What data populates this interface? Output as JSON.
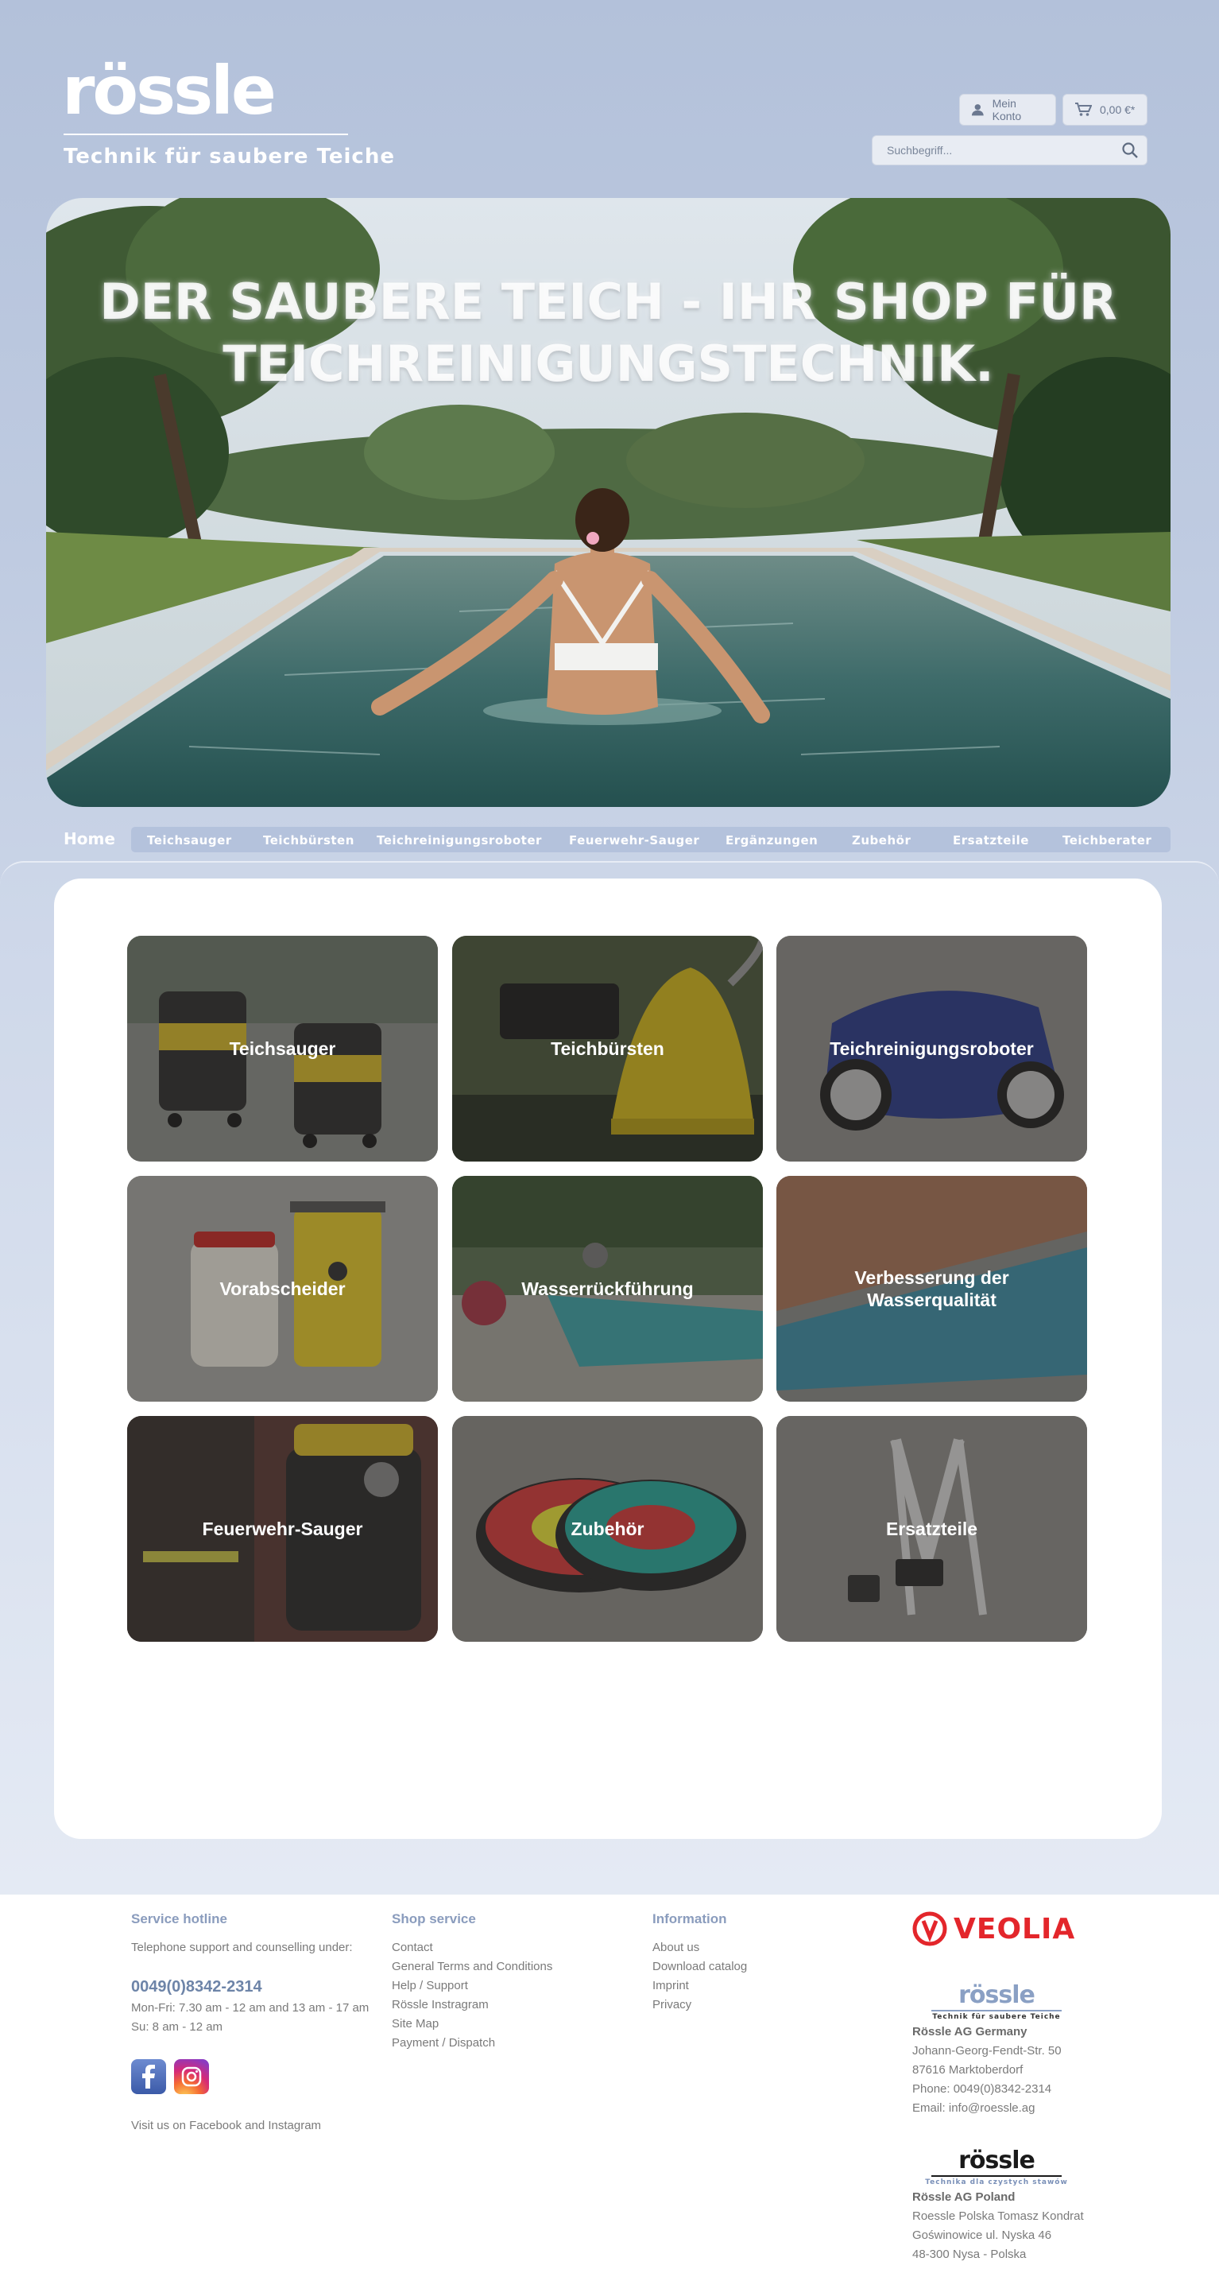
{
  "header": {
    "logo_word": "rössle",
    "tagline": "Technik für saubere Teiche",
    "account_label": "Mein Konto",
    "cart_total": "0,00 €*",
    "search_placeholder": "Suchbegriff..."
  },
  "hero": {
    "title": "DER SAUBERE TEICH - IHR SHOP FÜR TEICHREINIGUNGSTECHNIK."
  },
  "nav": {
    "home": "Home",
    "items": [
      "Teichsauger",
      "Teichbürsten",
      "Teichreinigungsroboter",
      "Feuerwehr-Sauger",
      "Ergänzungen",
      "Zubehör",
      "Ersatzteile",
      "Teichberater"
    ]
  },
  "categories": [
    {
      "label": "Teichsauger"
    },
    {
      "label": "Teichbürsten"
    },
    {
      "label": "Teichreinigungsroboter"
    },
    {
      "label": "Vorabscheider"
    },
    {
      "label": "Wasserrückführung"
    },
    {
      "label": "Verbesserung der Wasserqualität"
    },
    {
      "label": "Feuerwehr-Sauger"
    },
    {
      "label": "Zubehör"
    },
    {
      "label": "Ersatzteile"
    }
  ],
  "footer": {
    "service": {
      "heading": "Service hotline",
      "intro": "Telephone support and counselling under:",
      "phone": "0049(0)8342-2314",
      "hours1": "Mon-Fri: 7.30 am - 12 am and 13 am - 17 am",
      "hours2": "Su: 8 am - 12 am",
      "social_text": "Visit us on Facebook and Instagram"
    },
    "shop": {
      "heading": "Shop service",
      "links": [
        "Contact",
        "General Terms and Conditions",
        "Help / Support",
        "Rössle Instragram",
        "Site Map",
        "Payment / Dispatch"
      ]
    },
    "info": {
      "heading": "Information",
      "links": [
        "About us",
        "Download catalog",
        "Imprint",
        "Privacy"
      ]
    },
    "partner_logo": "VEOLIA",
    "germany": {
      "logo_word": "rössle",
      "logo_tagline": "Technik für saubere Teiche",
      "name": "Rössle AG Germany",
      "street": "Johann-Georg-Fendt-Str. 50",
      "city": "87616 Marktoberdorf",
      "phone": "Phone: 0049(0)8342-2314",
      "email_label": "Email:",
      "email": "info@roessle.ag"
    },
    "poland": {
      "logo_word": "rössle",
      "logo_tagline": "Technika dla czystych stawów",
      "name": "Rössle AG Poland",
      "line1": "Roessle Polska Tomasz Kondrat",
      "line2": "Goświnowice ul. Nyska 46",
      "line3": "48-300 Nysa - Polska"
    }
  },
  "colors": {
    "page_bg": "#b3c1da",
    "nav_bar": "#b4c2dc",
    "footer_heading": "#8a9cbd",
    "phone": "#6d84a8",
    "veolia_red": "#e3262b"
  }
}
